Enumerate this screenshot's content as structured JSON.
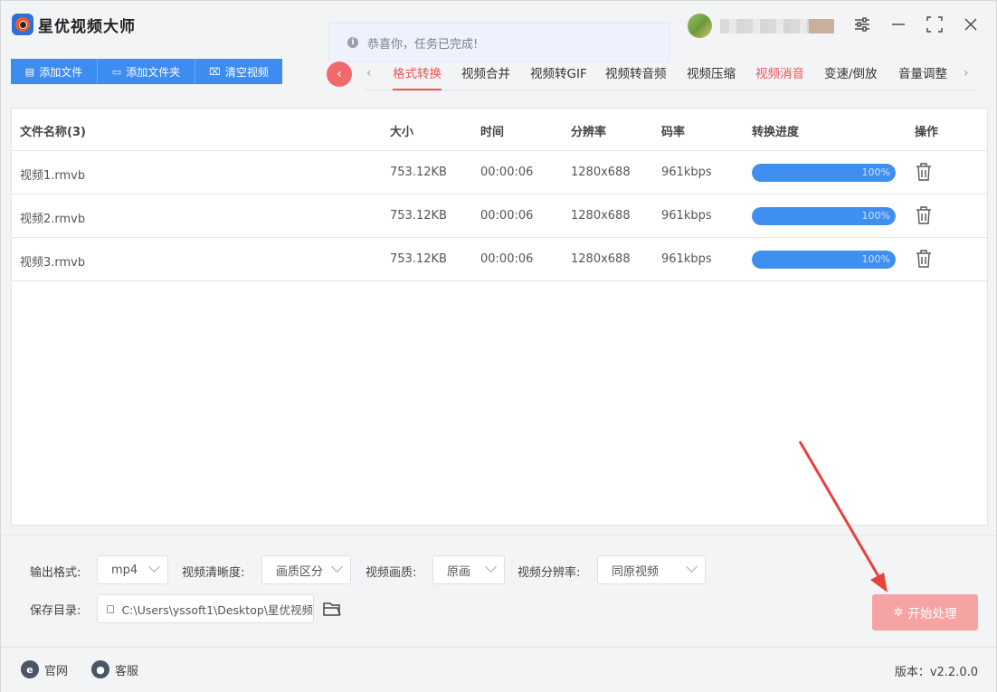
{
  "app": {
    "title": "星优视频大师"
  },
  "toast": {
    "message": "恭喜你，任务已完成!"
  },
  "toolbar": {
    "add_file": "添加文件",
    "add_folder": "添加文件夹",
    "clear": "清空视频"
  },
  "tabs": [
    {
      "label": "格式转换",
      "state": "active"
    },
    {
      "label": "视频合并"
    },
    {
      "label": "视频转GIF"
    },
    {
      "label": "视频转音频"
    },
    {
      "label": "视频压缩"
    },
    {
      "label": "视频消音",
      "state": "highlighted"
    },
    {
      "label": "变速/倒放"
    },
    {
      "label": "音量调整"
    }
  ],
  "table": {
    "headers": {
      "name": "文件名称(3)",
      "size": "大小",
      "time": "时间",
      "resolution": "分辨率",
      "bitrate": "码率",
      "progress": "转换进度",
      "action": "操作"
    },
    "rows": [
      {
        "name": "视频1.rmvb",
        "size": "753.12KB",
        "time": "00:00:06",
        "resolution": "1280x688",
        "bitrate": "961kbps",
        "progress_text": "100%",
        "progress": 1.0
      },
      {
        "name": "视频2.rmvb",
        "size": "753.12KB",
        "time": "00:00:06",
        "resolution": "1280x688",
        "bitrate": "961kbps",
        "progress_text": "100%",
        "progress": 1.0
      },
      {
        "name": "视频3.rmvb",
        "size": "753.12KB",
        "time": "00:00:06",
        "resolution": "1280x688",
        "bitrate": "961kbps",
        "progress_text": "100%",
        "progress": 1.0
      }
    ]
  },
  "settings": {
    "format_label": "输出格式:",
    "format_value": "mp4",
    "clarity_label": "视频清晰度:",
    "clarity_value": "画质区分",
    "quality_label": "视频画质:",
    "quality_value": "原画",
    "resolution_label": "视频分辨率:",
    "resolution_value": "同原视频",
    "save_label": "保存目录:",
    "save_path": "C:\\Users\\yssoft1\\Desktop\\星优视频",
    "start_label": "开始处理"
  },
  "statusbar": {
    "website": "官网",
    "service": "客服",
    "version": "版本：v2.2.0.0"
  },
  "colors": {
    "primary": "#3d8cf0",
    "accent_red": "#ef5757",
    "start_button": "#f5a3a3",
    "progress": "#3e8fef"
  }
}
